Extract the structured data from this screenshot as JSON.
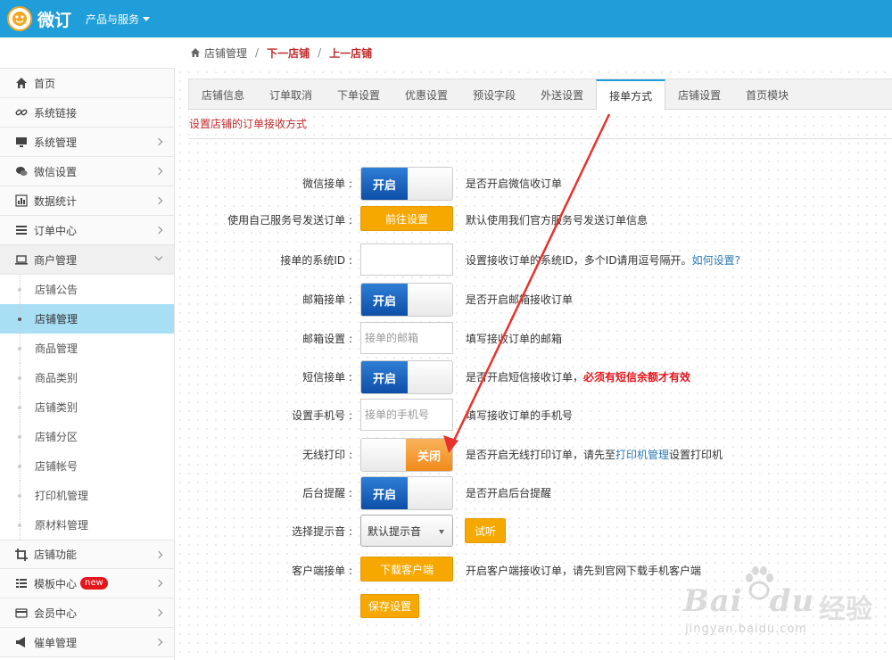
{
  "app": {
    "logo_text": "微订",
    "product_menu": "产品与服务"
  },
  "breadcrumb": {
    "root": "店铺管理",
    "next": "下一店铺",
    "prev": "上一店铺"
  },
  "sidebar": {
    "items": [
      {
        "label": "首页",
        "icon": "home-icon"
      },
      {
        "label": "系统链接",
        "icon": "link-icon"
      },
      {
        "label": "系统管理",
        "icon": "monitor-icon"
      },
      {
        "label": "微信设置",
        "icon": "chat-bubbles-icon"
      },
      {
        "label": "数据统计",
        "icon": "bar-chart-icon"
      },
      {
        "label": "订单中心",
        "icon": "list-icon"
      },
      {
        "label": "商户管理",
        "icon": "laptop-icon"
      }
    ],
    "subitems": [
      "店铺公告",
      "店铺管理",
      "商品管理",
      "商品类别",
      "店铺类别",
      "店铺分区",
      "店铺帐号",
      "打印机管理",
      "原材料管理"
    ],
    "bottom_items": [
      {
        "label": "店铺功能",
        "icon": "crop-icon"
      },
      {
        "label": "模板中心",
        "icon": "grid-list-icon",
        "badge": "new"
      },
      {
        "label": "会员中心",
        "icon": "card-icon"
      },
      {
        "label": "催单管理",
        "icon": "megaphone-icon"
      }
    ]
  },
  "tabs": [
    "店铺信息",
    "订单取消",
    "下单设置",
    "优惠设置",
    "预设字段",
    "外送设置",
    "接单方式",
    "店铺设置",
    "首页模块"
  ],
  "active_tab": "接单方式",
  "section_title": "设置店铺的订单接收方式",
  "form": {
    "wechat": {
      "label": "微信接单 :",
      "state": "开启",
      "hint": "是否开启微信收订单"
    },
    "own_service": {
      "label": "使用自己服务号发送订单 :",
      "button": "前往设置",
      "hint": "默认使用我们官方服务号发送订单信息"
    },
    "system_id": {
      "label": "接单的系统ID :",
      "value": "",
      "hint": "设置接收订单的系统ID，多个ID请用逗号隔开。",
      "hint_link": "如何设置?"
    },
    "email": {
      "label": "邮箱接单 :",
      "state": "开启",
      "hint": "是否开启邮箱接收订单"
    },
    "email_setting": {
      "label": "邮箱设置 :",
      "placeholder": "接单的邮箱",
      "hint": "填写接收订单的邮箱"
    },
    "sms": {
      "label": "短信接单 :",
      "state": "开启",
      "hint": "是否开启短信接收订单，",
      "hint_warn": "必须有短信余额才有效"
    },
    "phone": {
      "label": "设置手机号 :",
      "placeholder": "接单的手机号",
      "hint": "填写接收订单的手机号"
    },
    "wireless_print": {
      "label": "无线打印 :",
      "state": "关闭",
      "hint_pre": "是否开启无线打印订单，请先至",
      "hint_link": "打印机管理",
      "hint_post": "设置打印机"
    },
    "backend_alert": {
      "label": "后台提醒 :",
      "state": "开启",
      "hint": "是否开启后台提醒"
    },
    "sound": {
      "label": "选择提示音 :",
      "selected": "默认提示音",
      "button": "试听"
    },
    "client": {
      "label": "客户端接单 :",
      "button": "下载客户端",
      "hint": "开启客户端接收订单，请先到官网下载手机客户端"
    },
    "save_button": "保存设置"
  },
  "watermark": {
    "brand": "Bai",
    "brand_tail": "du",
    "cn": "经验",
    "url": "jingyan.baidu.com"
  },
  "colors": {
    "topbar": "#1f9ed9",
    "accent_red": "#c0292b",
    "toggle_on": "#0d4fa8",
    "toggle_off": "#f08a1a",
    "button_orange": "#f7a800",
    "active_sidebar": "#a8dff5",
    "annotation_arrow": "#e8322d"
  }
}
